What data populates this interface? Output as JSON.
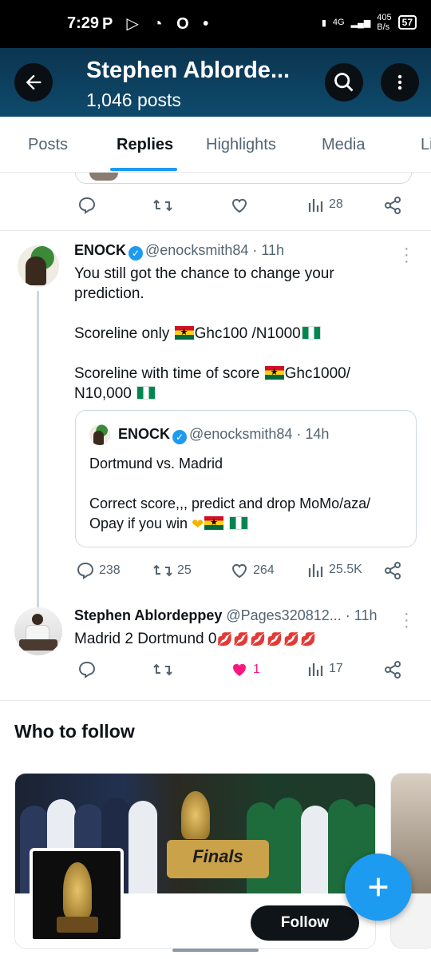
{
  "status_bar": {
    "time": "7:29",
    "icons_text": "P ▷ ◔ O •",
    "network": "4G",
    "speed": "405",
    "speed_unit": "B/s",
    "battery": "57"
  },
  "header": {
    "title": "Stephen Ablorde...",
    "subtitle": "1,046 posts"
  },
  "tabs": [
    {
      "label": "Posts"
    },
    {
      "label": "Replies"
    },
    {
      "label": "Highlights"
    },
    {
      "label": "Media"
    },
    {
      "label": "Li"
    }
  ],
  "prev_actions": {
    "views": "28"
  },
  "post1": {
    "name": "ENOCK",
    "handle": "@enocksmith84",
    "time": "· 11h",
    "line1": "You still got the chance to change your",
    "line2": "prediction.",
    "line3": "Scoreline only",
    "line3b": "Ghc100 /N1000",
    "line4": "Scoreline with time of score",
    "line4b": "Ghc1000/",
    "line5": "N10,000",
    "quote": {
      "name": "ENOCK",
      "handle": "@enocksmith84",
      "time": "· 14h",
      "line1": "Dortmund vs. Madrid",
      "line2": "Correct score,,, predict and drop MoMo/aza/",
      "line3": "Opay if you win"
    },
    "actions": {
      "replies": "238",
      "reposts": "25",
      "likes": "264",
      "views": "25.5K"
    }
  },
  "post2": {
    "name": "Stephen Ablordeppey",
    "handle": "@Pages320812...",
    "time": "· 11h",
    "text": "Madrid 2 Dortmund 0",
    "kisses": "💋💋💋💋💋💋",
    "actions": {
      "likes": "1",
      "views": "17"
    }
  },
  "who_to_follow": {
    "heading": "Who to follow",
    "banner_text": "Finals",
    "follow_label": "Follow"
  }
}
